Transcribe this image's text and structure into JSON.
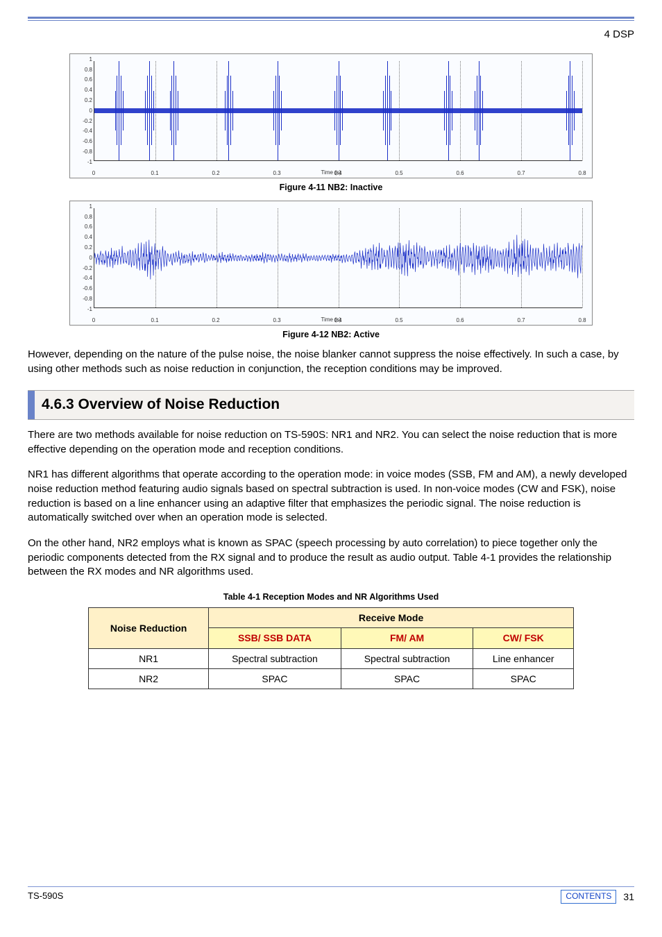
{
  "header": {
    "section": "4 DSP"
  },
  "chart_data": [
    {
      "type": "line",
      "title": "NB2: Inactive",
      "xlabel": "Time (s)",
      "ylabel": "",
      "xlim": [
        0,
        0.8
      ],
      "ylim": [
        -1,
        1
      ],
      "x_ticks": [
        0,
        0.1,
        0.2,
        0.3,
        0.4,
        0.5,
        0.6,
        0.7,
        0.8
      ],
      "y_ticks": [
        -1,
        -0.8,
        -0.6,
        -0.4,
        -0.2,
        0,
        0.2,
        0.4,
        0.6,
        0.8,
        1
      ],
      "series": [
        {
          "name": "baseline-noise",
          "description": "Continuous low-amplitude noise centered on 0, approx. ±0.05",
          "amplitude": 0.05
        },
        {
          "name": "impulse-spikes",
          "description": "Tall narrow pulse-noise bursts reaching near ±1",
          "spike_x": [
            0.04,
            0.09,
            0.13,
            0.22,
            0.3,
            0.4,
            0.48,
            0.58,
            0.63,
            0.78
          ],
          "spike_peak": 1.0
        }
      ]
    },
    {
      "type": "line",
      "title": "NB2: Active",
      "xlabel": "Time (s)",
      "ylabel": "",
      "xlim": [
        0,
        0.8
      ],
      "ylim": [
        -1,
        1
      ],
      "x_ticks": [
        0,
        0.1,
        0.2,
        0.3,
        0.4,
        0.5,
        0.6,
        0.7,
        0.8
      ],
      "y_ticks": [
        -1,
        -0.8,
        -0.6,
        -0.4,
        -0.2,
        0,
        0.2,
        0.4,
        0.6,
        0.8,
        1
      ],
      "series": [
        {
          "name": "audio-signal",
          "description": "Noise-blanked audio with variable bursts roughly ±0.1 to ±0.55 across the span; spikes largely removed",
          "envelope_samples": [
            {
              "x": 0.0,
              "amp": 0.18
            },
            {
              "x": 0.05,
              "amp": 0.3
            },
            {
              "x": 0.09,
              "amp": 0.45
            },
            {
              "x": 0.13,
              "amp": 0.2
            },
            {
              "x": 0.2,
              "amp": 0.12
            },
            {
              "x": 0.3,
              "amp": 0.12
            },
            {
              "x": 0.4,
              "amp": 0.1
            },
            {
              "x": 0.47,
              "amp": 0.4
            },
            {
              "x": 0.52,
              "amp": 0.5
            },
            {
              "x": 0.57,
              "amp": 0.25
            },
            {
              "x": 0.6,
              "amp": 0.5
            },
            {
              "x": 0.65,
              "amp": 0.35
            },
            {
              "x": 0.7,
              "amp": 0.5
            },
            {
              "x": 0.75,
              "amp": 0.3
            },
            {
              "x": 0.8,
              "amp": 0.55
            }
          ]
        }
      ]
    }
  ],
  "captions": {
    "fig1": "Figure 4-11   NB2: Inactive",
    "fig2": "Figure 4-12   NB2: Active",
    "table": "Table 4-1   Reception Modes and NR Algorithms Used"
  },
  "paragraphs": {
    "p1": "However, depending on the nature of the pulse noise, the noise blanker cannot suppress the noise effectively.  In such a case, by using other methods such as noise reduction in conjunction, the reception conditions may be improved.",
    "h463": "4.6.3  Overview of Noise Reduction",
    "p2": "There are two methods available for noise reduction on TS-590S: NR1 and NR2.  You can select the noise reduction that is more effective depending on the operation mode and reception conditions.",
    "p3": "NR1 has different algorithms that operate according to the operation mode: in voice modes (SSB, FM and AM), a newly developed noise reduction method featuring audio signals based on spectral subtraction is used.  In non-voice modes (CW and FSK), noise reduction is based on a line enhancer using an adaptive filter that emphasizes the periodic signal.  The noise reduction is automatically switched over when an operation mode is selected.",
    "p4": "On the other hand, NR2 employs what is known as SPAC (speech processing by auto correlation) to piece together only the periodic components detected from the RX signal and to produce the result as audio output.  Table 4-1 provides the relationship between the RX modes and NR algorithms used."
  },
  "table": {
    "h_nr": "Noise Reduction",
    "h_mode": "Receive Mode",
    "h_ssb": "SSB/ SSB DATA",
    "h_fm": "FM/ AM",
    "h_cw": "CW/ FSK",
    "rows": [
      {
        "nr": "NR1",
        "ssb": "Spectral subtraction",
        "fm": "Spectral subtraction",
        "cw": "Line enhancer"
      },
      {
        "nr": "NR2",
        "ssb": "SPAC",
        "fm": "SPAC",
        "cw": "SPAC"
      }
    ]
  },
  "footer": {
    "model": "TS-590S",
    "contents": "CONTENTS",
    "page": "31"
  }
}
